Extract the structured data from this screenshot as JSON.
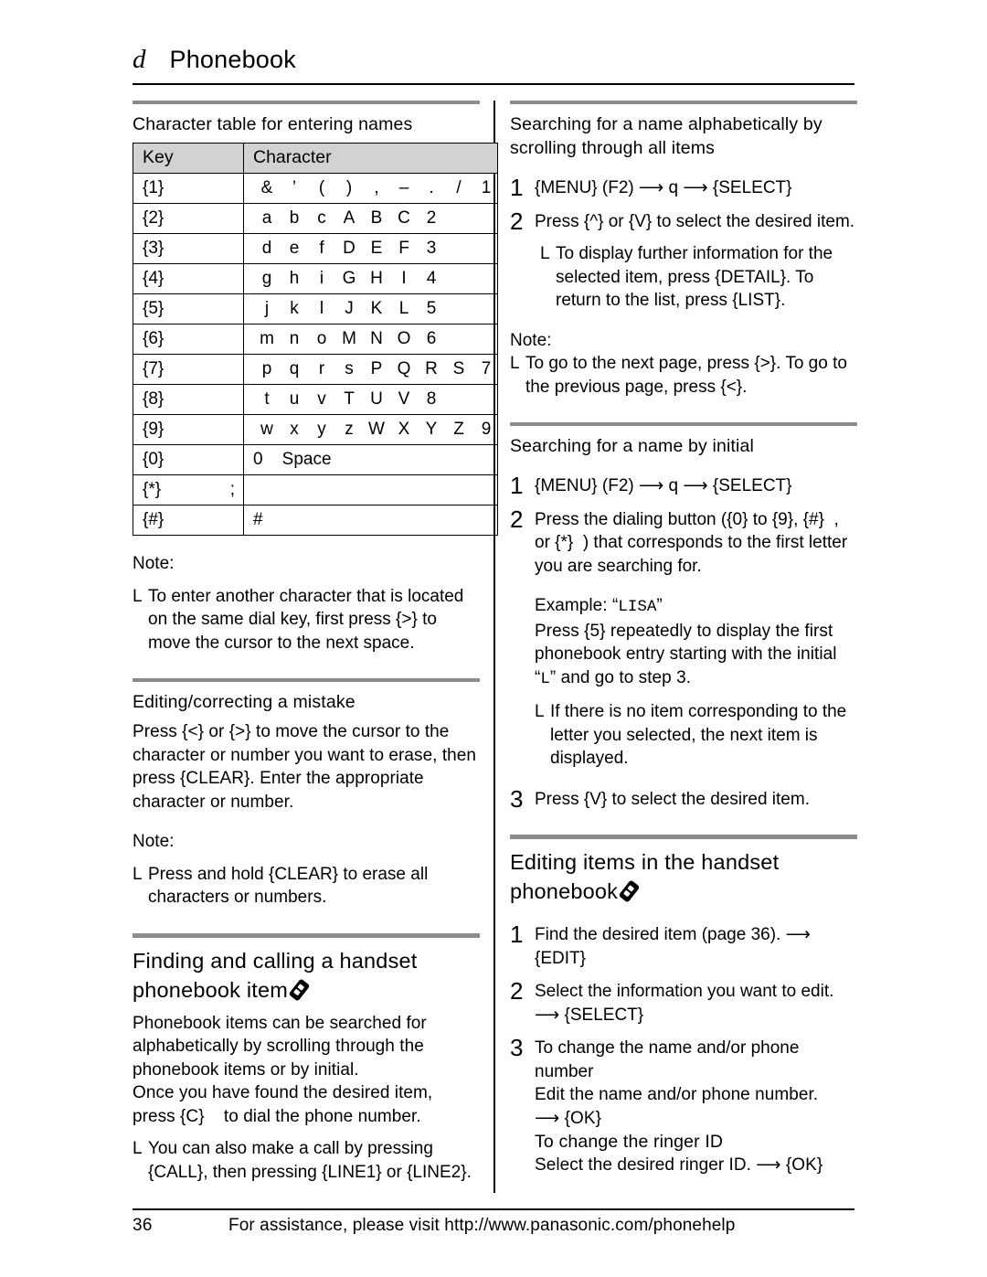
{
  "header": {
    "icon": "d",
    "icon_name": "handset-italic-d-icon",
    "title": "Phonebook"
  },
  "left_column": {
    "char_table": {
      "heading": "Character table for entering names",
      "columns": [
        "Key",
        "Character"
      ],
      "rows": [
        {
          "key": "{1}",
          "chars": [
            "&",
            "’",
            "(",
            ")",
            ",",
            "–",
            ".",
            "/",
            "1"
          ]
        },
        {
          "key": "{2}",
          "chars": [
            "a",
            "b",
            "c",
            "A",
            "B",
            "C",
            "2"
          ]
        },
        {
          "key": "{3}",
          "chars": [
            "d",
            "e",
            "f",
            "D",
            "E",
            "F",
            "3"
          ]
        },
        {
          "key": "{4}",
          "chars": [
            "g",
            "h",
            "i",
            "G",
            "H",
            "I",
            "4"
          ]
        },
        {
          "key": "{5}",
          "chars": [
            "j",
            "k",
            "l",
            "J",
            "K",
            "L",
            "5"
          ]
        },
        {
          "key": "{6}",
          "chars": [
            "m",
            "n",
            "o",
            "M",
            "N",
            "O",
            "6"
          ]
        },
        {
          "key": "{7}",
          "chars": [
            "p",
            "q",
            "r",
            "s",
            "P",
            "Q",
            "R",
            "S",
            "7"
          ]
        },
        {
          "key": "{8}",
          "chars": [
            "t",
            "u",
            "v",
            "T",
            "U",
            "V",
            "8"
          ]
        },
        {
          "key": "{9}",
          "chars": [
            "w",
            "x",
            "y",
            "z",
            "W",
            "X",
            "Y",
            "Z",
            "9"
          ]
        },
        {
          "key": "{0}",
          "chars_text": "0    Space"
        },
        {
          "key": "{*}",
          "key_extra": ";",
          "chars_text": ""
        },
        {
          "key": "{#}",
          "chars_text": "#"
        }
      ]
    },
    "note1": {
      "label": "Note:",
      "bullet_mark": "L",
      "bullet_text": "To enter another character that is located on the same dial key, first press {>} to move the cursor to the next space."
    },
    "editing": {
      "heading": "Editing/correcting a mistake",
      "body": "Press {<} or {>} to move the cursor to the character or number you want to erase, then press {CLEAR}. Enter the appropriate character or number."
    },
    "note2": {
      "label": "Note:",
      "bullet_mark": "L",
      "bullet_text": "Press and hold {CLEAR} to erase all characters or numbers."
    },
    "finding": {
      "heading": "Finding and calling a handset phonebook item",
      "heading_icon": "handset-icon",
      "body1": "Phonebook items can be searched for alphabetically by scrolling through the phonebook items or by initial.",
      "body2": "Once you have found the desired item, press {C}    to dial the phone number.",
      "bullet_mark": "L",
      "bullet_text": "You can also make a call by pressing {CALL}, then pressing {LINE1} or {LINE2}."
    }
  },
  "right_column": {
    "search_alpha": {
      "heading": "Searching for a name alphabetically by scrolling through all items",
      "steps": [
        {
          "num": "1",
          "text": "{MENU} (F2) ⟶ q   ⟶ {SELECT}"
        },
        {
          "num": "2",
          "text": "Press {^}  or {V} to select the desired item."
        }
      ],
      "sub_bullet_mark": "L",
      "sub_bullet_text": "To display further information for the selected item, press {DETAIL}. To return to the list, press {LIST}.",
      "note_label": "Note:",
      "note_bullet_mark": "L",
      "note_bullet_text": "To go to the next page, press {>}. To go to the previous page, press {<}."
    },
    "search_initial": {
      "heading": "Searching for a name by initial",
      "steps": [
        {
          "num": "1",
          "text": "{MENU} (F2) ⟶ q   ⟶ {SELECT}"
        },
        {
          "num": "2",
          "text": "Press the dialing button ({0} to {9}, {#}  , or {*}  ) that corresponds to the first letter you are searching for."
        }
      ],
      "example_label": "Example: ",
      "example_name": "LISA",
      "example_body_a": "Press {5} repeatedly to display the first phonebook entry starting with the initial ",
      "example_initial": "L",
      "example_body_b": " and go to step 3.",
      "example_bullet_mark": "L",
      "example_bullet_text": "If there is no item corresponding to the letter you selected, the next item is displayed.",
      "step3_num": "3",
      "step3_text": "Press {V} to select the desired item."
    },
    "editing_items": {
      "heading": "Editing items in the handset phonebook",
      "heading_icon": "handset-icon",
      "steps": [
        {
          "num": "1",
          "text": "Find the desired item (page 36). ⟶ {EDIT}"
        },
        {
          "num": "2",
          "text": "Select the information you want to edit. ⟶ {SELECT}"
        },
        {
          "num": "3",
          "text": "To change the name and/or phone number"
        }
      ],
      "step3_lines": [
        "Edit the name and/or phone number.",
        "⟶ {OK}",
        "To change the ringer ID",
        "Select the desired ringer ID. ⟶ {OK}"
      ]
    }
  },
  "footer": {
    "page_number": "36",
    "text": "For assistance, please visit http://www.panasonic.com/phonehelp"
  }
}
